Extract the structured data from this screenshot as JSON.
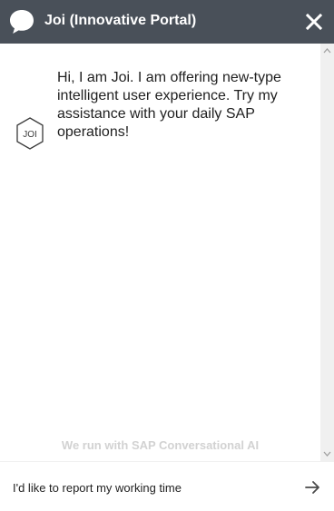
{
  "header": {
    "title": "Joi (Innovative Portal)",
    "logo_icon": "chat-bubble-icon",
    "close_icon": "close-icon",
    "background": "#495059"
  },
  "chat": {
    "messages": [
      {
        "sender": "bot",
        "avatar_text": "JOI",
        "text": "Hi, I am Joi. I am offering new-type intelligent user experience. Try my assistance with your daily SAP operations!"
      }
    ],
    "footer_note": "We run with SAP Conversational AI"
  },
  "input": {
    "value": "I'd like to report my working time",
    "send_icon": "arrow-right-icon"
  }
}
